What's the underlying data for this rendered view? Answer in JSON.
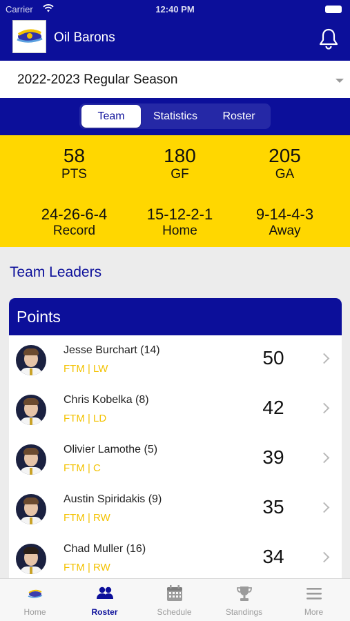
{
  "status_bar": {
    "carrier": "Carrier",
    "time": "12:40 PM"
  },
  "header": {
    "team_name": "Oil Barons"
  },
  "season_selector": {
    "value": "2022-2023 Regular Season"
  },
  "tabs": [
    {
      "label": "Team",
      "active": true
    },
    {
      "label": "Statistics",
      "active": false
    },
    {
      "label": "Roster",
      "active": false
    }
  ],
  "team_stats": {
    "pts": {
      "value": "58",
      "label": "PTS"
    },
    "gf": {
      "value": "180",
      "label": "GF"
    },
    "ga": {
      "value": "205",
      "label": "GA"
    },
    "record": {
      "value": "24-26-6-4",
      "label": "Record"
    },
    "home": {
      "value": "15-12-2-1",
      "label": "Home"
    },
    "away": {
      "value": "9-14-4-3",
      "label": "Away"
    }
  },
  "leaders": {
    "title": "Team Leaders",
    "category": "Points",
    "players": [
      {
        "name": "Jesse Burchart (14)",
        "position": "FTM | LW",
        "value": "50"
      },
      {
        "name": "Chris Kobelka (8)",
        "position": "FTM | LD",
        "value": "42"
      },
      {
        "name": "Olivier Lamothe (5)",
        "position": "FTM | C",
        "value": "39"
      },
      {
        "name": "Austin Spiridakis (9)",
        "position": "FTM | RW",
        "value": "35"
      },
      {
        "name": "Chad Muller (16)",
        "position": "FTM | RW",
        "value": "34"
      }
    ]
  },
  "tab_bar": [
    {
      "label": "Home",
      "icon": "team-logo-icon",
      "active": false
    },
    {
      "label": "Roster",
      "icon": "people-icon",
      "active": true
    },
    {
      "label": "Schedule",
      "icon": "calendar-icon",
      "active": false
    },
    {
      "label": "Standings",
      "icon": "trophy-icon",
      "active": false
    },
    {
      "label": "More",
      "icon": "menu-icon",
      "active": false
    }
  ],
  "colors": {
    "primary": "#0c0f9a",
    "accent": "#ffd700",
    "position_text": "#f3c200",
    "background": "#ececec"
  }
}
